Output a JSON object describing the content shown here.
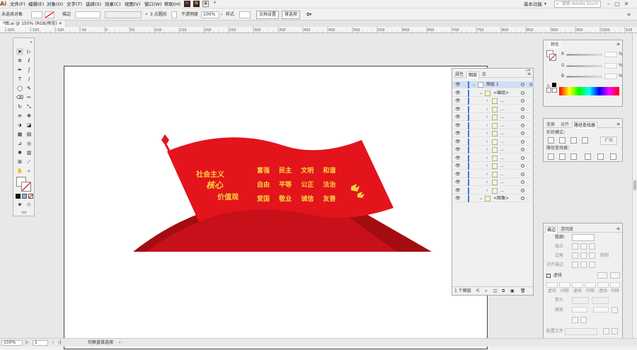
{
  "menubar": {
    "logo": "Ai",
    "items": [
      "文件(F)",
      "编辑(E)",
      "对象(O)",
      "文字(T)",
      "选择(S)",
      "效果(C)",
      "视图(V)",
      "窗口(W)",
      "帮助(H)"
    ],
    "br_icon": "Br",
    "st_icon": "St",
    "workspace": "基本功能",
    "search_placeholder": "搜索 Adobe Stock"
  },
  "controlbar": {
    "selection_label": "未选择对象",
    "stroke_label": "描边",
    "brush": "3 点圆形",
    "opacity_label": "不透明度",
    "opacity_value": "100%",
    "style_label": "样式",
    "doc_setup": "文档设置",
    "preferences": "首选项"
  },
  "document_tab": "*图.ai @ 150% (RGB/预览)",
  "ruler_ticks": [
    "-200",
    "-150",
    "-100",
    "-50",
    "0",
    "50",
    "100",
    "150",
    "200",
    "250",
    "300",
    "350",
    "400",
    "450",
    "500",
    "550",
    "600",
    "650",
    "700",
    "750",
    "800",
    "850",
    "900",
    "950",
    "1000",
    "1050"
  ],
  "artwork": {
    "left_col": [
      "社会主义",
      "核心",
      "价值观"
    ],
    "rows": [
      [
        "富强",
        "民主",
        "文明",
        "和谐"
      ],
      [
        "自由",
        "平等",
        "公正",
        "法治"
      ],
      [
        "爱国",
        "敬业",
        "诚信",
        "友善"
      ]
    ],
    "flag_red": "#e3141b",
    "text_yellow": "#f7d53f",
    "dark_red": "#a30d12"
  },
  "layers": {
    "tabs": [
      "属性",
      "图层",
      "库"
    ],
    "rows": [
      {
        "name": "图层 1",
        "level": 0
      },
      {
        "name": "<编组>",
        "level": 1
      },
      {
        "name": "...",
        "level": 2
      },
      {
        "name": "...",
        "level": 2
      },
      {
        "name": "...",
        "level": 2
      },
      {
        "name": "...",
        "level": 2
      },
      {
        "name": "...",
        "level": 2
      },
      {
        "name": "...",
        "level": 2
      },
      {
        "name": "...",
        "level": 2
      },
      {
        "name": "...",
        "level": 2
      },
      {
        "name": "...",
        "level": 2
      },
      {
        "name": "...",
        "level": 2
      },
      {
        "name": "...",
        "level": 2
      },
      {
        "name": "...",
        "level": 2
      },
      {
        "name": "<图像>",
        "level": 1
      }
    ],
    "footer": "1 个图层"
  },
  "color_panel": {
    "title": "颜色",
    "channels": [
      "R",
      "G",
      "B"
    ],
    "unit": "%"
  },
  "pathfinder": {
    "tabs": [
      "变换",
      "对齐",
      "路径查找器"
    ],
    "shape_modes": "形状模式：",
    "expand": "扩展",
    "pathfinders": "路径查找器："
  },
  "stroke_panel": {
    "tabs": [
      "描边",
      "透明度"
    ],
    "weight": "粗细：",
    "cap": "端点",
    "corner": "边角",
    "limit": "限制",
    "align": "对齐描边",
    "dashed": "虚线",
    "dash": "虚线",
    "gap": "间隙",
    "arrow": "箭头",
    "scale": "缩放",
    "profile": "配置文件"
  },
  "statusbar": {
    "zoom": "150%",
    "page": "1",
    "tool": "切换直接选择"
  }
}
